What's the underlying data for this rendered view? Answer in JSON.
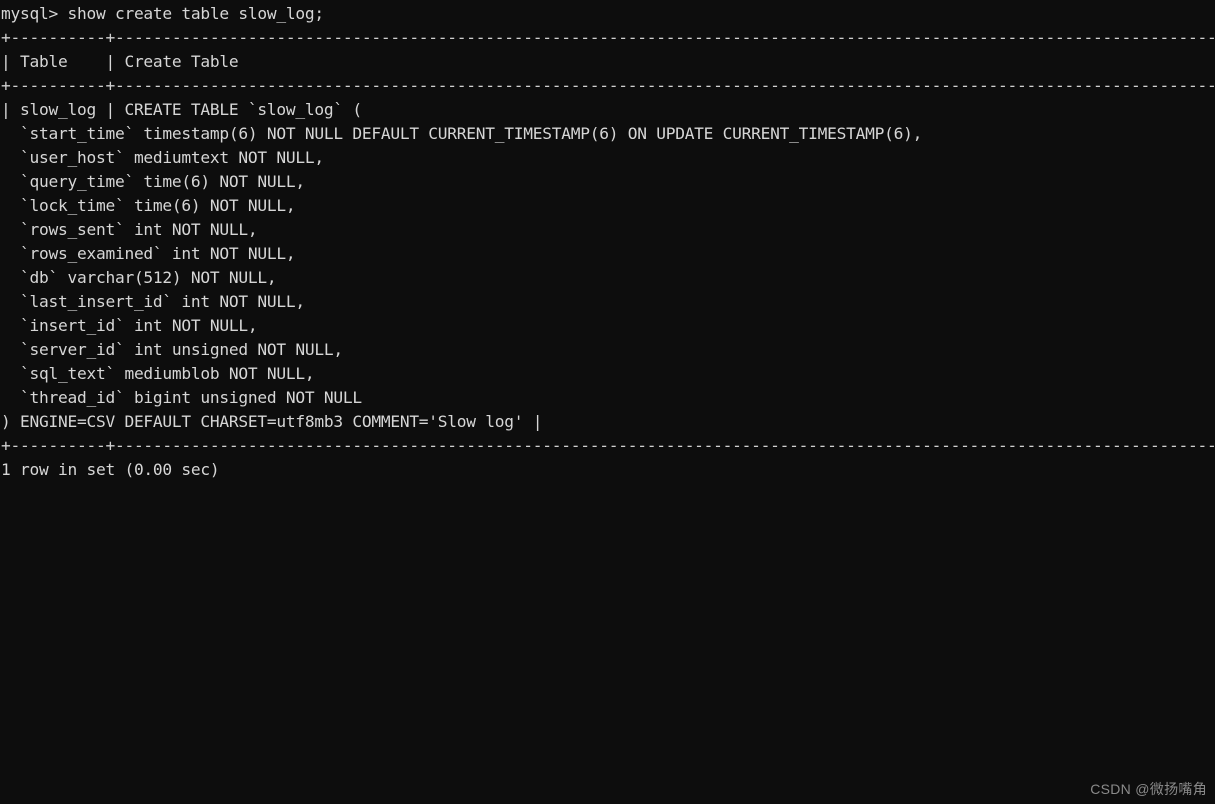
{
  "terminal": {
    "background_color": "#0d0d0d",
    "foreground_color": "#d6d6d6",
    "prompt": "mysql>",
    "command": "show create table slow_log;",
    "prompt_line": "mysql> show create table slow_log;",
    "separator_top": "+----------+-----------------------------------------------------------------------------------------------------------------------------------------------------------------------------------------------------------------------------------------------------------------------------------------------------------------------------------------------------------------+",
    "header_row": "| Table    | Create Table                                                                                                                                                                                                                                                                                                                                       |",
    "separator_mid": "+----------+-----------------------------------------------------------------------------------------------------------------------------------------------------------------------------------------------------------------------------------------------------------------------------------------------------------------------------------------------------------------+",
    "separator_bottom": "+----------+-----------------------------------------------------------------------------------------------------------------------------------------------------------------------------------------------------------------------------------------------------------------------------------------------------------------------------------------------------------------+",
    "status_line": "1 row in set (0.00 sec)",
    "row": {
      "table_name": "slow_log",
      "create_table_lines": [
        "| slow_log | CREATE TABLE `slow_log` (",
        "  `start_time` timestamp(6) NOT NULL DEFAULT CURRENT_TIMESTAMP(6) ON UPDATE CURRENT_TIMESTAMP(6),",
        "  `user_host` mediumtext NOT NULL,",
        "  `query_time` time(6) NOT NULL,",
        "  `lock_time` time(6) NOT NULL,",
        "  `rows_sent` int NOT NULL,",
        "  `rows_examined` int NOT NULL,",
        "  `db` varchar(512) NOT NULL,",
        "  `last_insert_id` int NOT NULL,",
        "  `insert_id` int NOT NULL,",
        "  `server_id` int unsigned NOT NULL,",
        "  `sql_text` mediumblob NOT NULL,",
        "  `thread_id` bigint unsigned NOT NULL",
        ") ENGINE=CSV DEFAULT CHARSET=utf8mb3 COMMENT='Slow log' |"
      ]
    },
    "columns": [
      {
        "name": "start_time",
        "type": "timestamp(6)",
        "nullable": "NOT NULL",
        "extra": "DEFAULT CURRENT_TIMESTAMP(6) ON UPDATE CURRENT_TIMESTAMP(6)"
      },
      {
        "name": "user_host",
        "type": "mediumtext",
        "nullable": "NOT NULL",
        "extra": ""
      },
      {
        "name": "query_time",
        "type": "time(6)",
        "nullable": "NOT NULL",
        "extra": ""
      },
      {
        "name": "lock_time",
        "type": "time(6)",
        "nullable": "NOT NULL",
        "extra": ""
      },
      {
        "name": "rows_sent",
        "type": "int",
        "nullable": "NOT NULL",
        "extra": ""
      },
      {
        "name": "rows_examined",
        "type": "int",
        "nullable": "NOT NULL",
        "extra": ""
      },
      {
        "name": "db",
        "type": "varchar(512)",
        "nullable": "NOT NULL",
        "extra": ""
      },
      {
        "name": "last_insert_id",
        "type": "int",
        "nullable": "NOT NULL",
        "extra": ""
      },
      {
        "name": "insert_id",
        "type": "int",
        "nullable": "NOT NULL",
        "extra": ""
      },
      {
        "name": "server_id",
        "type": "int unsigned",
        "nullable": "NOT NULL",
        "extra": ""
      },
      {
        "name": "sql_text",
        "type": "mediumblob",
        "nullable": "NOT NULL",
        "extra": ""
      },
      {
        "name": "thread_id",
        "type": "bigint unsigned",
        "nullable": "NOT NULL",
        "extra": ""
      }
    ],
    "table_options": {
      "engine": "CSV",
      "charset": "utf8mb3",
      "comment": "Slow log"
    },
    "rows_returned": "1 row in set",
    "duration": "(0.00 sec)"
  },
  "watermark": {
    "text": "CSDN @微扬嘴角"
  }
}
